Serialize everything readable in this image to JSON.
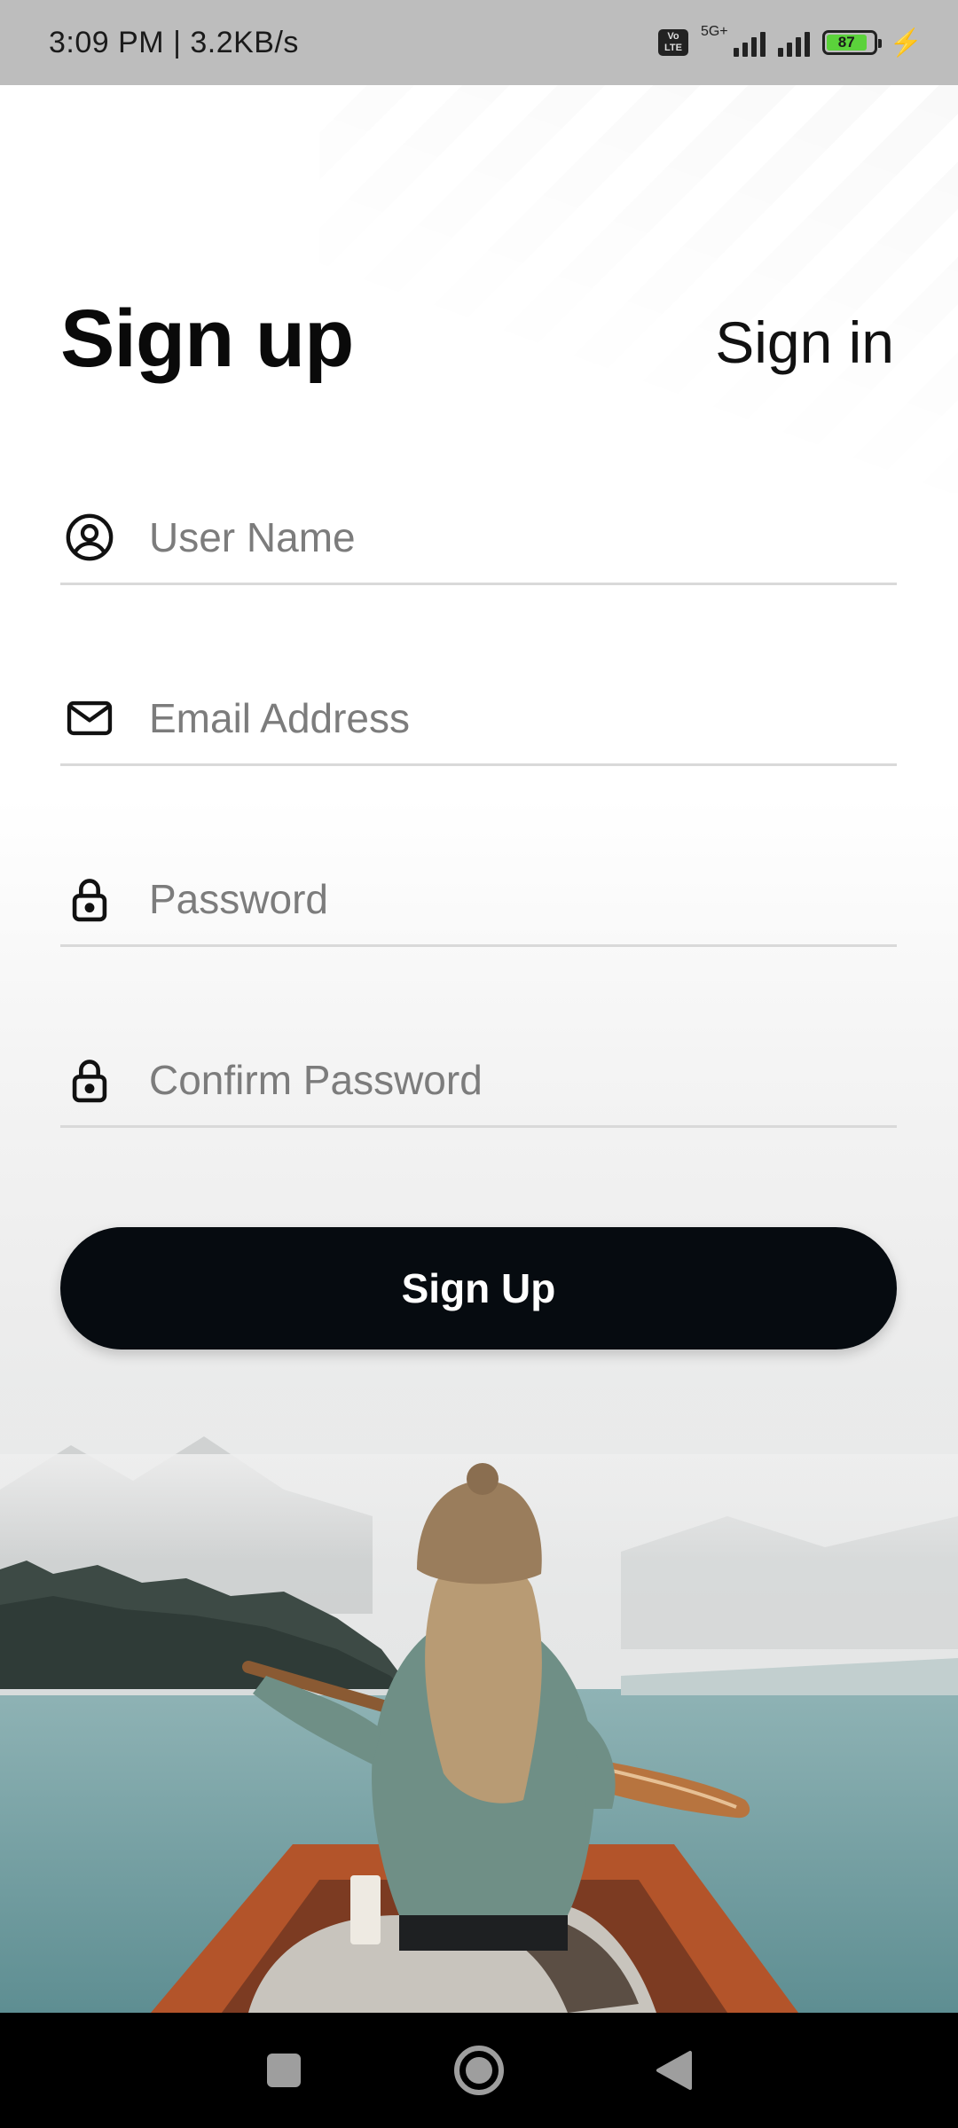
{
  "status_bar": {
    "time_speed": "3:09 PM | 3.2KB/s",
    "volte": "Vo LTE",
    "network": "5G+",
    "battery": "87"
  },
  "header": {
    "title": "Sign up",
    "alt_link": "Sign in"
  },
  "form": {
    "username": {
      "placeholder": "User Name",
      "value": "",
      "icon": "user-circle-icon"
    },
    "email": {
      "placeholder": "Email Address",
      "value": "",
      "icon": "mail-icon"
    },
    "password": {
      "placeholder": "Password",
      "value": "",
      "icon": "lock-icon"
    },
    "confirm_password": {
      "placeholder": "Confirm Password",
      "value": "",
      "icon": "lock-icon"
    },
    "submit_label": "Sign Up"
  },
  "colors": {
    "button_bg": "#060b10",
    "text_primary": "#0a0a0a",
    "placeholder": "#7c7c7c",
    "divider": "#d9d9d9"
  },
  "nav_bar": {
    "buttons": [
      "recents-icon",
      "home-icon",
      "back-icon"
    ]
  }
}
